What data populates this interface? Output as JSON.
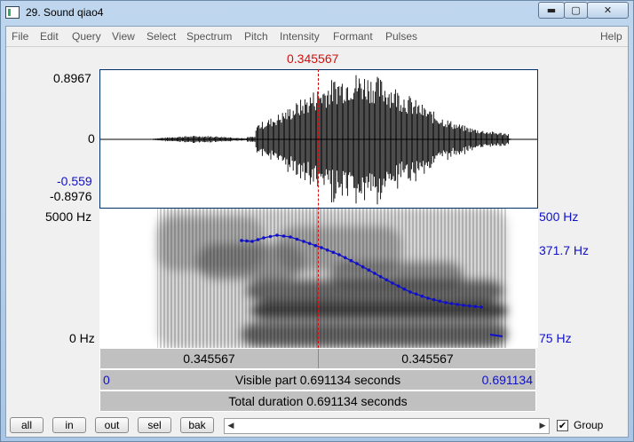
{
  "window": {
    "title": "29. Sound qiao4",
    "minimize": "▬",
    "maximize": "▢",
    "close": "✕"
  },
  "menu": [
    "File",
    "Edit",
    "Query",
    "View",
    "Select",
    "Spectrum",
    "Pitch",
    "Intensity",
    "Formant",
    "Pulses",
    "Help"
  ],
  "cursor": {
    "time_label": "0.345567",
    "color": "#d01010"
  },
  "waveform": {
    "max_label": "0.8967",
    "zero_label": "0",
    "cursor_value_label": "-0.559",
    "min_label": "-0.8976"
  },
  "spectrogram": {
    "top_label": "5000 Hz",
    "bottom_label": "0 Hz",
    "pitch_top_label": "500 Hz",
    "pitch_value_label": "371.7 Hz",
    "pitch_bottom_label": "75 Hz",
    "pitch_color": "#1010c8"
  },
  "bars": {
    "left_segment": "0.345567",
    "right_segment": "0.345567",
    "visible_start": "0",
    "visible_text": "Visible part 0.691134 seconds",
    "visible_end": "0.691134",
    "total_text": "Total duration 0.691134 seconds"
  },
  "bottom": {
    "buttons": [
      "all",
      "in",
      "out",
      "sel",
      "bak"
    ],
    "group_label": "Group",
    "group_checked": "✔",
    "scroll_left": "◀",
    "scroll_right": "▶"
  }
}
